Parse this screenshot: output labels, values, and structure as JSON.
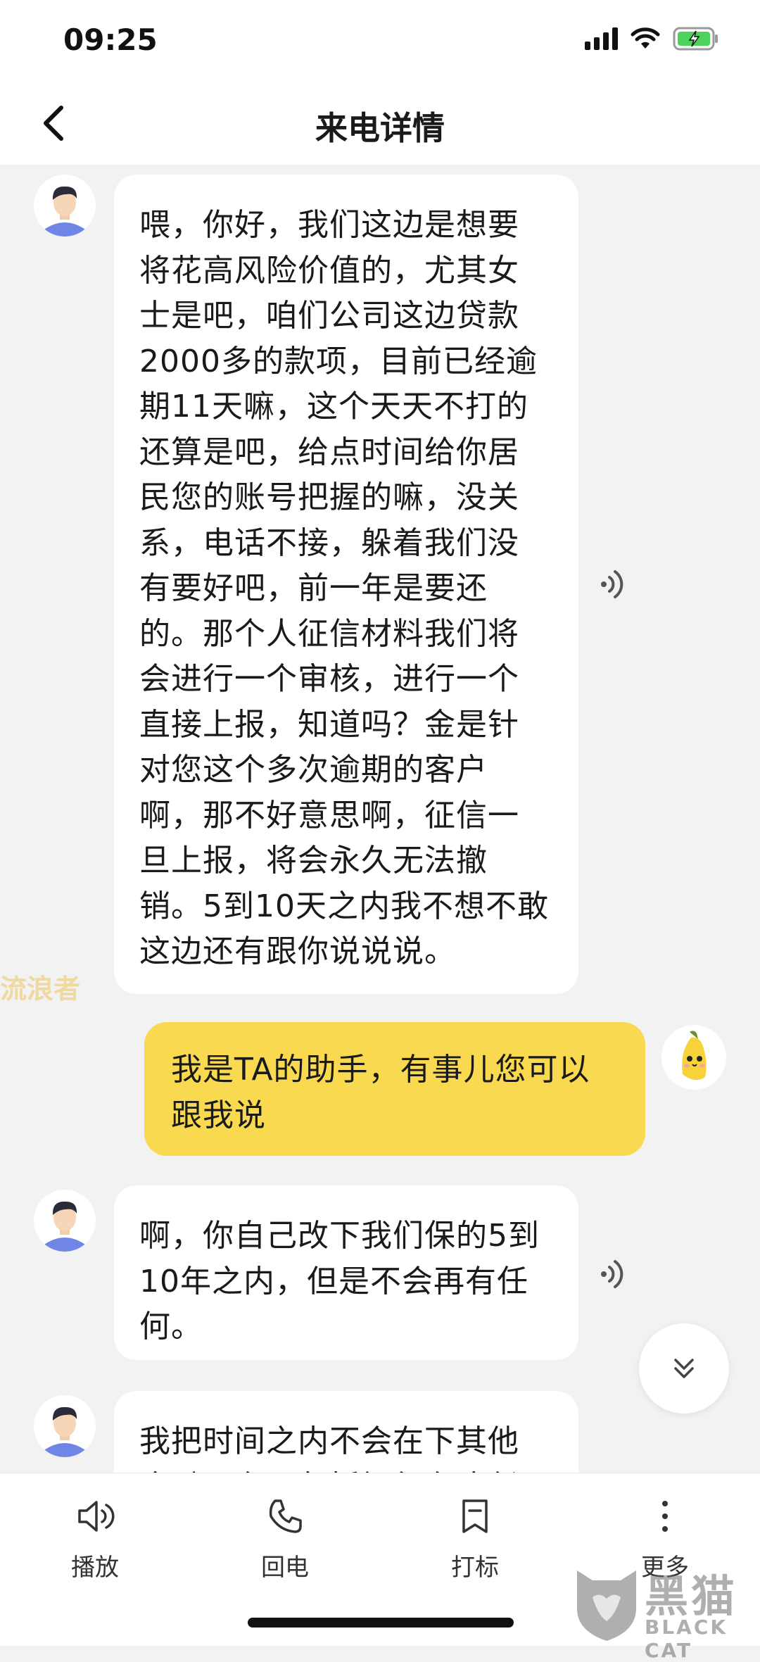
{
  "status_bar": {
    "time": "09:25"
  },
  "header": {
    "title": "来电详情"
  },
  "messages": [
    {
      "side": "left",
      "text": "喂，你好，我们这边是想要\n将花高风险价值的，尤其女\n士是吧，咱们公司这边贷款\n2000多的款项，目前已经逾\n期11天嘛，这个天天不打的\n还算是吧，给点时间给你居\n民您的账号把握的嘛，没关\n系，电话不接，躲着我们没\n有要好吧，前一年是要还\n的。那个人征信材料我们将\n会进行一个审核，进行一个\n直接上报，知道吗？金是针\n对您这个多次逾期的客户\n啊，那不好意思啊，征信一\n旦上报，将会永久无法撤\n销。5到10天之内我不想不敢\n这边还有跟你说说说。",
      "has_audio": true
    },
    {
      "side": "right",
      "text": "我是TA的助手，有事儿您可以\n跟我说"
    },
    {
      "side": "left",
      "text": "啊，你自己改下我们保的5到\n10年之内，但是不会再有任\n何。",
      "has_audio": true
    },
    {
      "side": "left",
      "text": "我把时间之内不会在下其他\n金融平台，包括银行在这任",
      "partial": true
    }
  ],
  "watermark": {
    "side_text": "流浪者",
    "brand_cn": "黑猫",
    "brand_en": "BLACK CAT"
  },
  "toolbar": {
    "items": [
      {
        "label": "播放",
        "icon": "speaker-icon"
      },
      {
        "label": "回电",
        "icon": "phone-icon"
      },
      {
        "label": "打标",
        "icon": "bookmark-icon"
      },
      {
        "label": "更多",
        "icon": "more-icon"
      }
    ]
  },
  "colors": {
    "assistant_bubble": "#f8d94f",
    "caller_bubble": "#ffffff",
    "background": "#f2f2f3"
  }
}
